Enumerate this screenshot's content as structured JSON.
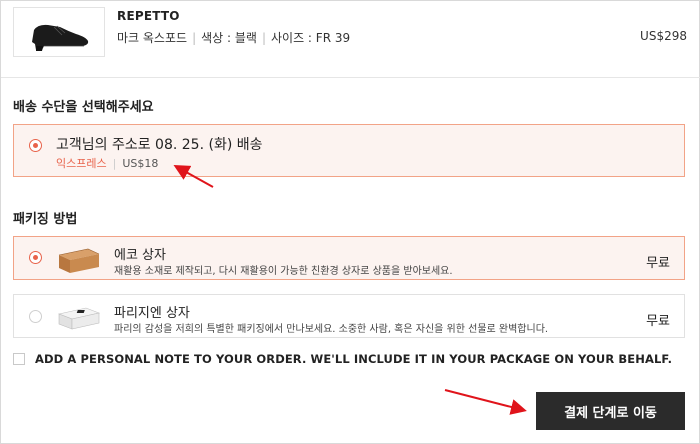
{
  "product": {
    "brand": "REPETTO",
    "name": "마크 옥스포드",
    "color": "색상 : 블랙",
    "size": "사이즈 : FR 39",
    "price": "US$298"
  },
  "shipping": {
    "heading": "배송 수단을 선택해주세요",
    "option": {
      "title": "고객님의 주소로 08. 25. (화) 배송",
      "method": "익스프레스",
      "cost": "US$18",
      "selected": true
    }
  },
  "packaging": {
    "heading": "패키징 방법",
    "options": [
      {
        "title": "에코 상자",
        "description": "재활용 소재로 제작되고, 다시 재활용이 가능한 친환경 상자로 상품을 받아보세요.",
        "price": "무료",
        "selected": true,
        "icon": "eco-box-icon"
      },
      {
        "title": "파리지엔 상자",
        "description": "파리의 감성을 저희의 특별한 패키징에서 만나보세요. 소중한 사람, 혹은 자신을 위한 선물로 완벽합니다.",
        "price": "무료",
        "selected": false,
        "icon": "parisian-box-icon"
      }
    ]
  },
  "note": {
    "label": "ADD A PERSONAL NOTE TO YOUR ORDER. WE'LL INCLUDE IT IN YOUR PACKAGE ON YOUR BEHALF.",
    "checked": false
  },
  "checkout": {
    "label": "결제 단계로 이동"
  },
  "colors": {
    "accent": "#e8634b",
    "selected_border": "#f2a387",
    "selected_bg": "#fcf3f0",
    "button_bg": "#2b2b2b",
    "annotation_arrow": "#e0141b"
  }
}
